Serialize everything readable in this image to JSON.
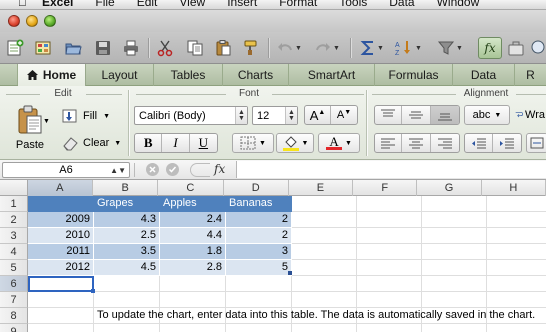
{
  "menubar": {
    "items": [
      "Excel",
      "File",
      "Edit",
      "View",
      "Insert",
      "Format",
      "Tools",
      "Data",
      "Window"
    ]
  },
  "toolbar": {
    "icons": [
      "new-sheet-icon",
      "gallery-icon",
      "open-folder-icon",
      "save-icon",
      "print-icon",
      "cut-icon",
      "copy-icon",
      "paste-icon",
      "format-painter-icon",
      "undo-icon",
      "redo-icon",
      "autosum-icon",
      "sort-icon",
      "filter-icon",
      "formula-builder-icon"
    ],
    "fx_label": "fx"
  },
  "ribbon_tabs": {
    "items": [
      "Home",
      "Layout",
      "Tables",
      "Charts",
      "SmartArt",
      "Formulas",
      "Data",
      "R"
    ],
    "active": "Home"
  },
  "ribbon": {
    "edit": {
      "group_label": "Edit",
      "paste_label": "Paste",
      "fill_label": "Fill",
      "clear_label": "Clear"
    },
    "font": {
      "group_label": "Font",
      "font_name": "Calibri (Body)",
      "font_size": "12",
      "bold": "B",
      "italic": "I",
      "underline": "U",
      "grow": "A",
      "shrink": "A",
      "font_color_letter": "A",
      "highlight_color": "#f7e41b",
      "font_color": "#e3262a"
    },
    "alignment": {
      "group_label": "Alignment",
      "wrap_label": "abc",
      "wrap_text": "Wra"
    }
  },
  "formula_bar": {
    "name_box": "A6",
    "fx": "fx",
    "formula": ""
  },
  "sheet": {
    "columns": [
      "A",
      "B",
      "C",
      "D",
      "E",
      "F",
      "G",
      "H"
    ],
    "selected_column": "A",
    "selected_row": "6",
    "rows": [
      {
        "n": "1",
        "cells": [
          "",
          "Grapes",
          "Apples",
          "Bananas",
          "",
          "",
          "",
          ""
        ]
      },
      {
        "n": "2",
        "cells": [
          "2009",
          "4.3",
          "2.4",
          "2",
          "",
          "",
          "",
          ""
        ]
      },
      {
        "n": "3",
        "cells": [
          "2010",
          "2.5",
          "4.4",
          "2",
          "",
          "",
          "",
          ""
        ]
      },
      {
        "n": "4",
        "cells": [
          "2011",
          "3.5",
          "1.8",
          "3",
          "",
          "",
          "",
          ""
        ]
      },
      {
        "n": "5",
        "cells": [
          "2012",
          "4.5",
          "2.8",
          "5",
          "",
          "",
          "",
          ""
        ]
      },
      {
        "n": "6",
        "cells": [
          "",
          "",
          "",
          "",
          "",
          "",
          "",
          ""
        ]
      },
      {
        "n": "7",
        "cells": [
          "",
          "",
          "",
          "",
          "",
          "",
          "",
          ""
        ]
      },
      {
        "n": "8",
        "cells": [
          "",
          "To update the chart, enter data into this table. The data is automatically saved in the chart.",
          "",
          "",
          "",
          "",
          "",
          ""
        ]
      },
      {
        "n": "9",
        "cells": [
          "",
          "",
          "",
          "",
          "",
          "",
          "",
          ""
        ]
      }
    ],
    "table_header_color": "#4f81bd",
    "band_light": "#dbe5f1",
    "band_dark": "#b8cce4"
  }
}
